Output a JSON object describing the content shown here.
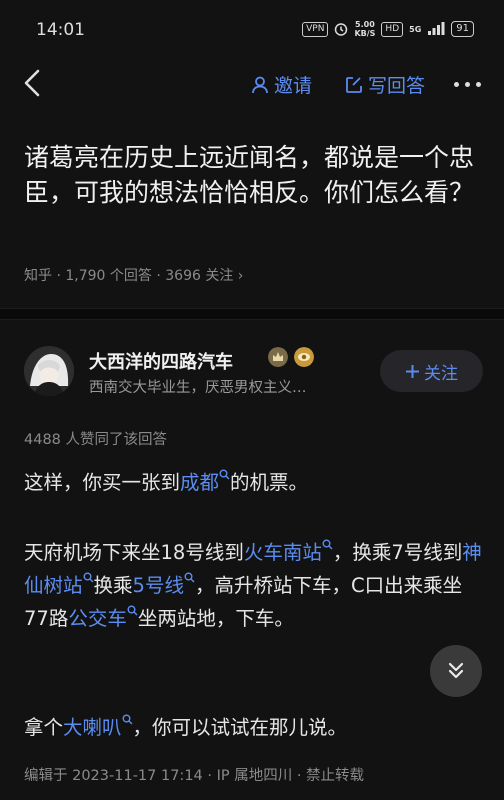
{
  "status_bar": {
    "time": "14:01",
    "vpn": "VPN",
    "speed_value": "5.00",
    "speed_unit": "KB/S",
    "hd": "HD",
    "network": "5G",
    "battery": "91"
  },
  "nav": {
    "invite_label": "邀请",
    "write_answer_label": "写回答",
    "accent_color": "#5b8cf0"
  },
  "question": {
    "title": "诸葛亮在历史上远近闻名，都说是一个忠臣，可我的想法恰恰相反。你们怎么看？",
    "source": "知乎",
    "answers": "1,790",
    "answers_label": " 个回答 · ",
    "followers": "3696",
    "followers_label": " 关注 ›"
  },
  "author": {
    "name": "大西洋的四路汽车",
    "bio": "西南交大毕业生，厌恶男权主义…",
    "follow_label": "关注"
  },
  "answer": {
    "vote_text": "4488 人赞同了该回答",
    "p1_pre": "这样，你买一张到",
    "p1_kw1": "成都",
    "p1_post": "的机票。",
    "p2_pre": "天府机场下来坐18号线到",
    "p2_kw1": "火车南站",
    "p2_mid1": "，换乘7号线到",
    "p2_kw2": "神仙树站",
    "p2_mid2": "换乘",
    "p2_kw3": "5号线",
    "p2_mid3": "，高升桥站下车，C口出来乘坐77路",
    "p2_kw4": "公交车",
    "p2_post": "坐两站地，下车。",
    "p3_pre": "拿个",
    "p3_kw1": "大喇叭",
    "p3_post": "，你可以试试在那儿说。",
    "edit_meta": "编辑于 2023-11-17 17:14 · IP 属地四川 · 禁止转载"
  },
  "icons": [
    "back-icon",
    "invite-icon",
    "edit-icon",
    "more-icon",
    "search-icon",
    "chevron-double-down-icon"
  ]
}
